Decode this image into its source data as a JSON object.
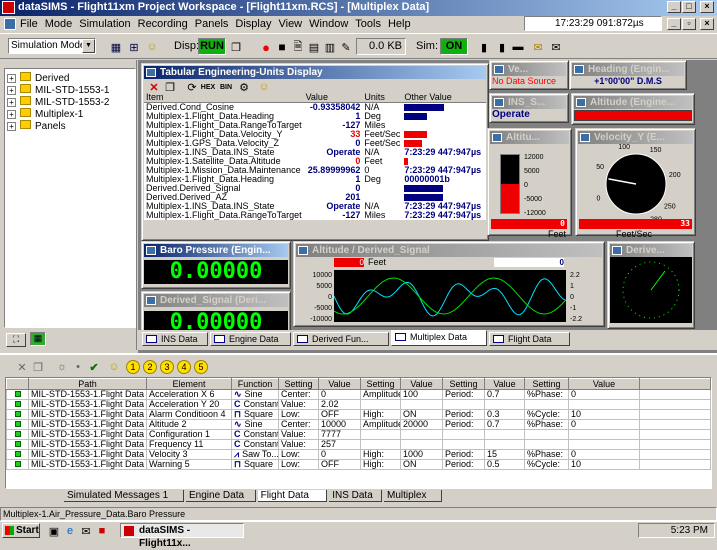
{
  "window": {
    "title": "dataSIMS - Flight11xm Project Workspace - [Flight11xm.RCS] - [Multiplex Data]"
  },
  "menu": [
    "File",
    "Mode",
    "Simulation",
    "Recording",
    "Panels",
    "Display",
    "View",
    "Window",
    "Tools",
    "Help"
  ],
  "clock": "17:23:29 091:872µs",
  "toolbar": {
    "mode": "Simulation Mode",
    "disp_label": "Disp:",
    "disp_state": "RUN",
    "size": "0.0 KB",
    "sim_label": "Sim:",
    "sim_state": "ON"
  },
  "tree": [
    "Derived",
    "MIL-STD-1553-1",
    "MIL-STD-1553-2",
    "Multiplex-1",
    "Panels"
  ],
  "te": {
    "title": "Tabular Engineering-Units Display",
    "headers": [
      "Item",
      "Value",
      "Units",
      "Other Value"
    ],
    "rows": [
      {
        "item": "Derived.Cond_Cosine",
        "value": "-0.93358042",
        "red": "t",
        "units": "N/A",
        "other": "",
        "bar": 50
      },
      {
        "item": "Multiplex-1.Flight_Data.Heading",
        "value": "1",
        "red": "",
        "units": "Deg",
        "other": "",
        "bar": 28
      },
      {
        "item": "Multiplex-1.Flight_Data.RangeToTarget",
        "value": "-127",
        "red": "",
        "units": "Miles",
        "other": "",
        "bar": 0
      },
      {
        "item": "Multiplex-1.Flight_Data.Velocity_Y",
        "value": "33",
        "red": "r",
        "units": "Feet/Sec",
        "other": "",
        "bar": 28,
        "barcolor": "#ee0000"
      },
      {
        "item": "Multiplex-1.GPS_Data.Velocity_Z",
        "value": "0",
        "red": "",
        "units": "Feet/Sec",
        "other": "",
        "bar": 22,
        "barcolor": "#ee0000"
      },
      {
        "item": "Multiplex-1.INS_Data.INS_State",
        "value": "Operate",
        "red": "",
        "units": "N/A",
        "other": "7:23:29 447:947µs",
        "bar": 0
      },
      {
        "item": "Multiplex-1.Satellite_Data.Altitude",
        "value": "0",
        "red": "r",
        "units": "Feet",
        "other": "",
        "bar": 5,
        "barcolor": "#ee0000"
      },
      {
        "item": "Multiplex-1.Mission_Data.Maintenance",
        "value": "25.89999962",
        "red": "",
        "units": "0",
        "other": "7:23:29 447:947µs",
        "bar": 0
      },
      {
        "item": "Multiplex-1.Flight_Data.Heading",
        "value": "1",
        "red": "",
        "units": "Deg",
        "other": "00000001b",
        "bar": 0
      },
      {
        "item": "Derived.Derived_Signal",
        "value": "0",
        "red": "",
        "units": "",
        "other": "",
        "bar": 48
      },
      {
        "item": "Derived.Derived_AZ",
        "value": "201",
        "red": "",
        "units": "",
        "other": "",
        "bar": 48
      },
      {
        "item": "Multiplex-1.INS_Data.INS_State",
        "value": "Operate",
        "red": "",
        "units": "N/A",
        "other": "7:23:29 447:947µs",
        "bar": 0
      },
      {
        "item": "Multiplex-1.Flight_Data.RangeToTarget",
        "value": "-127",
        "red": "",
        "units": "Miles",
        "other": "7:23:29 447:947µs",
        "bar": 0
      }
    ]
  },
  "small_panels": {
    "ve": {
      "title": "Ve...",
      "text": "No Data Source"
    },
    "heading": {
      "title": "Heading (Engin...",
      "value": "+1°00'00\"",
      "unit": "D.M.S"
    },
    "ins": {
      "title": "INS_S...",
      "value": "Operate"
    },
    "altitude_eng": {
      "title": "Altitude (Engine..."
    },
    "altitude_bar": {
      "title": "Altitu...",
      "ticks": [
        "12000",
        "5000",
        "0",
        "-5000",
        "-12000"
      ],
      "value": "0",
      "unit": "Feet"
    },
    "velocity": {
      "title": "Velocity_Y (E...",
      "ticks": [
        "0",
        "50",
        "100",
        "150",
        "200",
        "250",
        "280"
      ],
      "value": "33",
      "unit": "Feet/Sec",
      "needle_deg": 33
    },
    "baro": {
      "title": "Baro Pressure (Engin...",
      "value": "0.00000"
    },
    "derived_sig": {
      "title": "Derived_Signal (Deri...",
      "value": "0.00000"
    },
    "altderiv": {
      "title": "Altitude / Derived_Signal",
      "left_val": "0",
      "left_unit": "Feet",
      "right_val": "0",
      "lticks": [
        "10000",
        "5000",
        "0",
        "-5000",
        "-10000"
      ],
      "rticks": [
        "2.2",
        "1",
        "0",
        "-1",
        "-2.2"
      ]
    },
    "derive2": {
      "title": "Derive..."
    }
  },
  "mdi_tabs": [
    "INS Data",
    "Engine Data",
    "Derived Fun...",
    "Multiplex Data",
    "Flight Data"
  ],
  "bottom_toolbar": {
    "numbers": [
      "1",
      "2",
      "3",
      "4",
      "5"
    ]
  },
  "grid": {
    "headers": [
      "Path",
      "Element",
      "Function",
      "Setting",
      "Value",
      "Setting",
      "Value",
      "Setting",
      "Value",
      "Setting",
      "Value"
    ],
    "rows": [
      [
        "MIL-STD-1553-1.Flight Data",
        "Acceleration X 6",
        "Sine",
        "Center:",
        "0",
        "Amplitude:",
        "100",
        "Period:",
        "0.7",
        "%Phase:",
        "0"
      ],
      [
        "MIL-STD-1553-1.Flight Data",
        "Acceleration Y 20",
        "Constant",
        "Value:",
        "2.02",
        "",
        "",
        "",
        "",
        "",
        ""
      ],
      [
        "MIL-STD-1553-1.Flight Data",
        "Alarm Conditioon 4",
        "Square",
        "Low:",
        "OFF",
        "High:",
        "ON",
        "Period:",
        "0.3",
        "%Cycle:",
        "10"
      ],
      [
        "MIL-STD-1553-1.Flight Data",
        "Altitude 2",
        "Sine",
        "Center:",
        "10000",
        "Amplitude:",
        "20000",
        "Period:",
        "0.7",
        "%Phase:",
        "0"
      ],
      [
        "MIL-STD-1553-1.Flight Data",
        "Configuration 1",
        "Constant",
        "Value:",
        "7777",
        "",
        "",
        "",
        "",
        "",
        ""
      ],
      [
        "MIL-STD-1553-1.Flight Data",
        "Frequency 11",
        "Constant",
        "Value:",
        "257",
        "",
        "",
        "",
        "",
        "",
        ""
      ],
      [
        "MIL-STD-1553-1.Flight Data",
        "Velocity 3",
        "Saw To...",
        "Low:",
        "0",
        "High:",
        "1000",
        "Period:",
        "15",
        "%Phase:",
        "0"
      ],
      [
        "MIL-STD-1553-1.Flight Data",
        "Warning 5",
        "Square",
        "Low:",
        "OFF",
        "High:",
        "ON",
        "Period:",
        "0.5",
        "%Cycle:",
        "10"
      ]
    ]
  },
  "bottom_tabs": [
    "Simulated Messages 1",
    "Engine Data",
    "Flight Data",
    "INS Data",
    "Multiplex"
  ],
  "status": "Multiplex-1.Air_Pressure_Data.Baro Pressure",
  "taskbar": {
    "start": "Start",
    "task": "dataSIMS - Flight11x...",
    "time": "5:23 PM"
  }
}
